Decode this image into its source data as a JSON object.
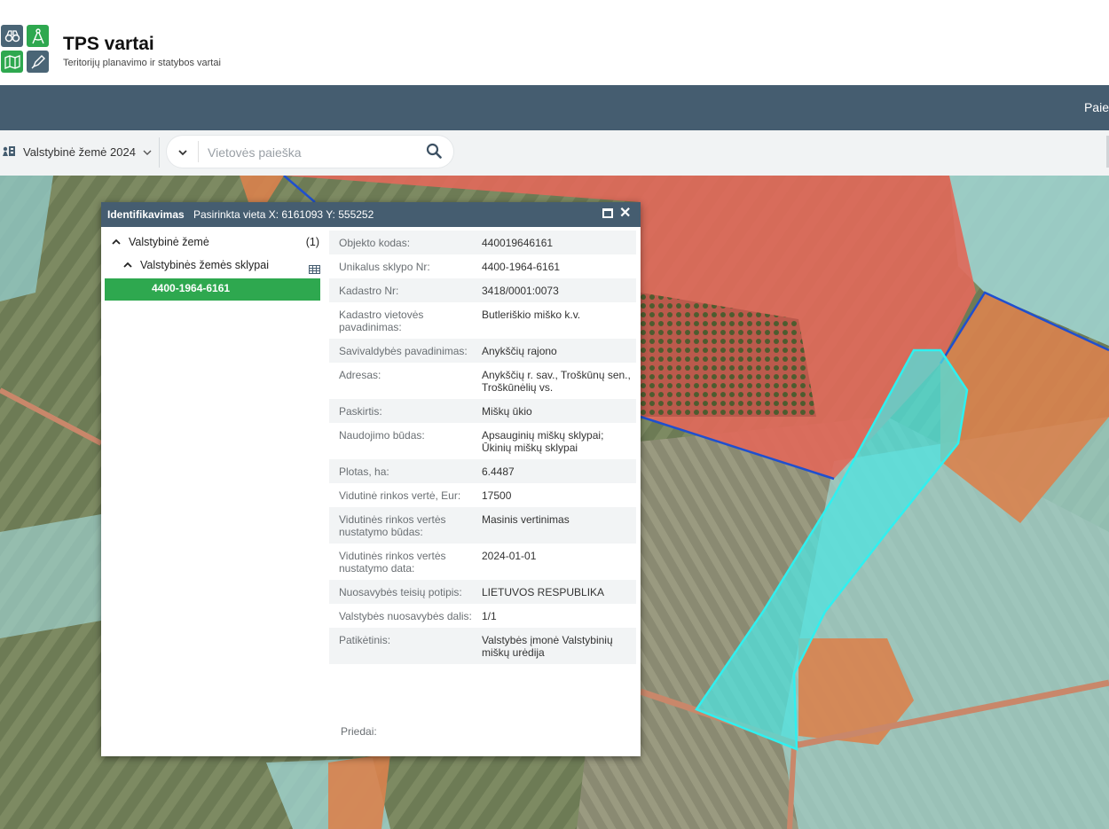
{
  "app": {
    "title": "TPS vartai",
    "subtitle": "Teritorijų planavimo ir statybos vartai",
    "logo_icons": [
      "binoculars-icon",
      "compass-icon",
      "map-icon",
      "pen-icon"
    ]
  },
  "navbar": {
    "right_item": "Paie"
  },
  "toolbar": {
    "layer_label": "Valstybinė žemė 2024",
    "search_placeholder": "Vietovės paieška",
    "search_value": ""
  },
  "panel": {
    "title": "Identifikavimas",
    "location_info": "Pasirinkta vieta X: 6161093 Y: 555252",
    "tree": {
      "layer": "Valstybinė žemė",
      "layer_count": "(1)",
      "sublayer": "Valstybinės žemės sklypai",
      "selected_item": "4400-1964-6161"
    },
    "attributes": [
      {
        "key": "Objekto kodas:",
        "value": "440019646161"
      },
      {
        "key": "Unikalus sklypo Nr:",
        "value": "4400-1964-6161"
      },
      {
        "key": "Kadastro Nr:",
        "value": "3418/0001:0073"
      },
      {
        "key": "Kadastro vietovės pavadinimas:",
        "value": "Butleriškio miško k.v."
      },
      {
        "key": "Savivaldybės pavadinimas:",
        "value": "Anykščių rajono"
      },
      {
        "key": "Adresas:",
        "value": "Anykščių r. sav., Troškūnų sen., Troškūnėlių vs."
      },
      {
        "key": "Paskirtis:",
        "value": "Miškų ūkio"
      },
      {
        "key": "Naudojimo būdas:",
        "value": "Apsauginių miškų sklypai; Ūkinių miškų sklypai"
      },
      {
        "key": "Plotas, ha:",
        "value": "6.4487"
      },
      {
        "key": "Vidutinė rinkos vertė, Eur:",
        "value": "17500"
      },
      {
        "key": "Vidutinės rinkos vertės nustatymo būdas:",
        "value": "Masinis vertinimas"
      },
      {
        "key": "Vidutinės rinkos vertės nustatymo data:",
        "value": "2024-01-01"
      },
      {
        "key": "Nuosavybės teisių potipis:",
        "value": "LIETUVOS RESPUBLIKA"
      },
      {
        "key": "Valstybės nuosavybės dalis:",
        "value": "1/1"
      },
      {
        "key": "Patikėtinis:",
        "value": "Valstybės įmonė Valstybinių miškų urėdija"
      }
    ],
    "attachments_label": "Priedai:"
  },
  "colors": {
    "navbar": "#455d70",
    "accent_green": "#2ea84f",
    "parcel_selected": "#4fe3e0",
    "parcel_red": "#e0695a",
    "parcel_orange": "#d9824e",
    "parcel_teal": "#9fd3cf",
    "boundary_blue": "#1f4fcf"
  }
}
